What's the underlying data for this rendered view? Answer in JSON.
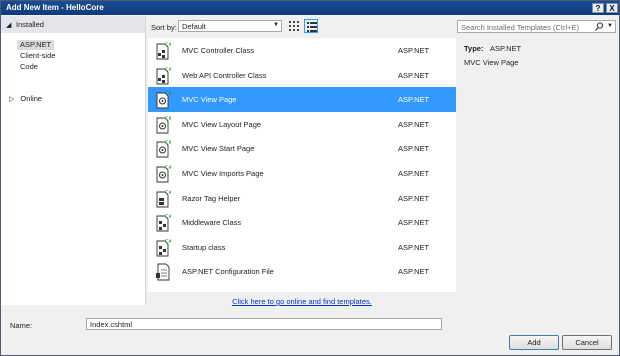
{
  "window": {
    "title": "Add New Item - HelloCore",
    "help": "?",
    "close": "X"
  },
  "left": {
    "installed": "Installed",
    "installed_arrow": "◢",
    "items": [
      "ASP.NET",
      "Client-side",
      "Code"
    ],
    "online": "Online",
    "online_arrow": "▷"
  },
  "toolbar": {
    "sort_label": "Sort by:",
    "sort_value": "Default"
  },
  "templates": [
    {
      "name": "MVC Controller Class",
      "lang": "ASP.NET",
      "icon": "controller-class-icon"
    },
    {
      "name": "Web API Controller Class",
      "lang": "ASP.NET",
      "icon": "controller-class-icon"
    },
    {
      "name": "MVC View Page",
      "lang": "ASP.NET",
      "icon": "razor-page-icon",
      "selected": true
    },
    {
      "name": "MVC View Layout Page",
      "lang": "ASP.NET",
      "icon": "razor-page-icon"
    },
    {
      "name": "MVC View Start Page",
      "lang": "ASP.NET",
      "icon": "razor-page-icon"
    },
    {
      "name": "MVC View Imports Page",
      "lang": "ASP.NET",
      "icon": "razor-page-icon"
    },
    {
      "name": "Razor Tag Helper",
      "lang": "ASP.NET",
      "icon": "tag-helper-icon"
    },
    {
      "name": "Middleware Class",
      "lang": "ASP.NET",
      "icon": "class-icon"
    },
    {
      "name": "Startup class",
      "lang": "ASP.NET",
      "icon": "class-icon"
    },
    {
      "name": "ASP.NET Configuration File",
      "lang": "ASP.NET",
      "icon": "config-file-icon"
    }
  ],
  "online_link": "Click here to go online and find templates.",
  "search": {
    "placeholder": "Search Installed Templates (Ctrl+E)"
  },
  "details": {
    "type_label": "Type:",
    "type_value": "ASP.NET",
    "description": "MVC View Page"
  },
  "name_field": {
    "label": "Name:",
    "value": "Index.cshtml"
  },
  "buttons": {
    "add": "Add",
    "cancel": "Cancel"
  },
  "colors": {
    "selection": "#3399ff",
    "titlebar": "#1b4b93",
    "link": "#0033cc"
  }
}
